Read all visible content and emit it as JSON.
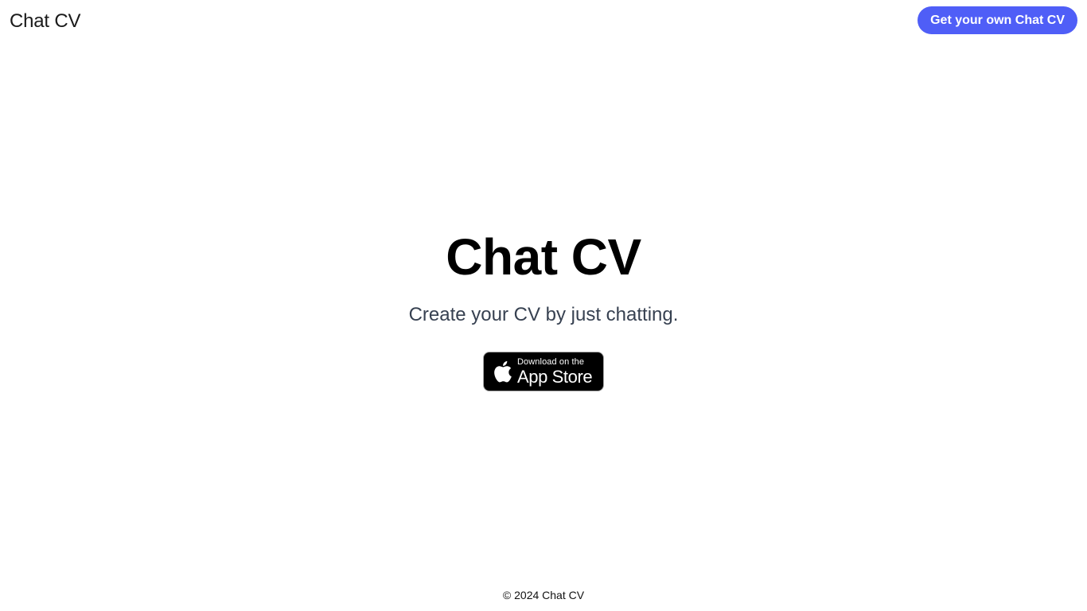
{
  "header": {
    "brand": "Chat CV",
    "cta_label": "Get your own Chat CV",
    "cta_color": "#4f5ef7"
  },
  "hero": {
    "title": "Chat CV",
    "subtitle": "Create your CV by just chatting.",
    "badge": {
      "icon": "apple-icon",
      "small_text": "Download on the",
      "large_text": "App Store"
    }
  },
  "footer": {
    "copyright": "© 2024 Chat CV"
  }
}
